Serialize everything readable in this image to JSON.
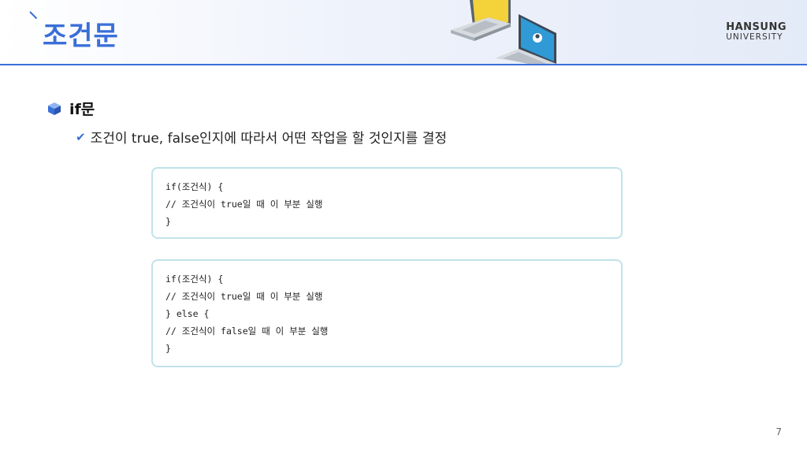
{
  "header": {
    "title": "조건문",
    "logo_line1": "HANSUNG",
    "logo_line2": "UNIVERSITY"
  },
  "content": {
    "bullet_main": "if문",
    "bullet_sub": "조건이 true, false인지에 따라서 어떤 작업을 할 것인지를 결정"
  },
  "code_blocks": [
    {
      "lines": [
        "if(조건식) {",
        "// 조건식이 true일 때 이 부분 실행",
        "}"
      ]
    },
    {
      "lines": [
        "if(조건식) {",
        "// 조건식이 true일 때 이 부분 실행",
        "} else {",
        "// 조건식이 false일 때 이 부분 실행",
        "}"
      ]
    }
  ],
  "page_number": "7",
  "colors": {
    "accent": "#3a6fd8",
    "code_border": "#bfe3ea"
  },
  "icons": [
    "cube-icon",
    "check-icon",
    "laptops-illustration"
  ]
}
